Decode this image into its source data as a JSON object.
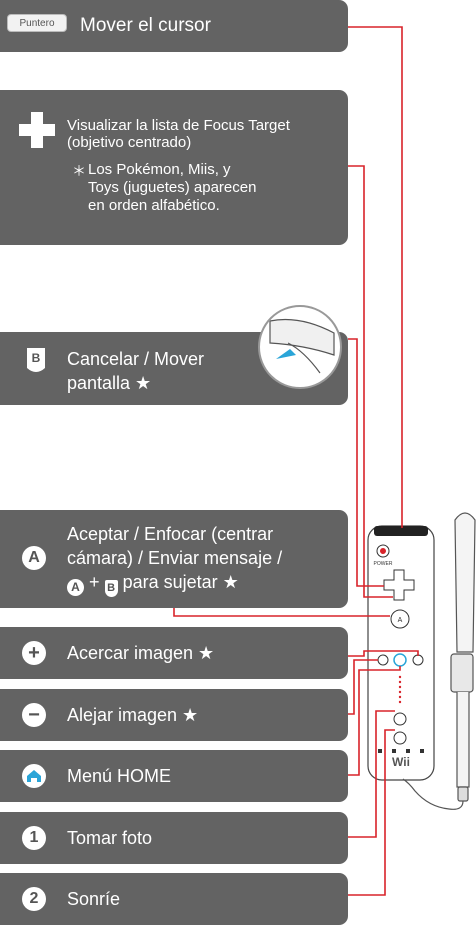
{
  "rows": {
    "pointer": {
      "badge": "Puntero",
      "label": "Mover el cursor"
    },
    "dpad": {
      "line1": "Visualizar la lista de Focus Target",
      "line2": "(objetivo centrado)",
      "note_mark": "＊",
      "note1": "Los Pokémon, Miis, y",
      "note2": "Toys (juguetes) aparecen",
      "note3": "en orden alfabético."
    },
    "b": {
      "line1": "Cancelar / Mover",
      "line2": "pantalla ★"
    },
    "a": {
      "line1": "Aceptar / Enfocar (centrar",
      "line2": "cámara) / Enviar mensaje /",
      "line3_suffix": "para sujetar ★",
      "plus": "+"
    },
    "plus": {
      "symbol": "+",
      "label": "Acercar imagen ★"
    },
    "minus": {
      "symbol": "−",
      "label": "Alejar imagen ★"
    },
    "home": {
      "label": "Menú HOME"
    },
    "one": {
      "symbol": "1",
      "label": "Tomar foto"
    },
    "two": {
      "symbol": "2",
      "label": "Sonríe"
    }
  },
  "remote": {
    "power_text": "POWER",
    "a_text": "A",
    "brand": "Wii"
  },
  "colors": {
    "panel": "#636363",
    "line": "#d8232a",
    "home_blue": "#2aa5d8"
  }
}
